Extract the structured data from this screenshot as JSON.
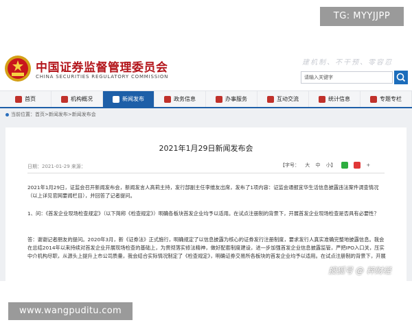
{
  "overlay": {
    "tg_badge": "TG: MYYJJPP",
    "bottom_badge": "www.wangpuditu.com",
    "watermark": "搜狐号 @ 粹财经"
  },
  "header": {
    "org_name_cn": "中国证券监督管理委员会",
    "org_name_en": "CHINA SECURITIES REGULATORY COMMISSION",
    "slogan": "建机制、不干预、零容忍",
    "search_placeholder": "请输入关键字"
  },
  "nav": {
    "items": [
      {
        "label": "首页",
        "active": false
      },
      {
        "label": "机构概况",
        "active": false
      },
      {
        "label": "新闻发布",
        "active": true
      },
      {
        "label": "政务信息",
        "active": false
      },
      {
        "label": "办事服务",
        "active": false
      },
      {
        "label": "互动交流",
        "active": false
      },
      {
        "label": "统计信息",
        "active": false
      },
      {
        "label": "专题专栏",
        "active": false
      }
    ]
  },
  "breadcrumb": "当前位置：首页>新闻发布>新闻发布会",
  "article": {
    "title": "2021年1月29日新闻发布会",
    "meta": "日期：2021-01-29  来源：",
    "font_label": "【字号：",
    "font_big": "大",
    "font_mid": "中",
    "font_small": "小】",
    "para1": "2021年1月29日，证监会召开新闻发布会，新闻发言人高莉主持，发行部副主任李维友出席，发布了1项内容：证监会通报宜华生活信息披露违法案件调查情况（以上详见官网要闻栏目），并回答了记者提问。",
    "para2": "1、问：《首发企业现场检查规定》（以下简称《检查规定》）明确各板块首发企业均予以适用。在试点注册制的背景下，开展首发企业现场检查是否具有必要性？",
    "para3": "答：谢谢记者朋友的提问。2020年3月，新《证券法》正式施行，明确规定了以信息披露为核心的证券发行注册制度，要求发行人真实准确完整地披露信息。我会在总结2014年以来持续对首发企业开展现场检查的基础上，为贯彻落实修法精神，做好配套制度建设，进一步加强首发企业信息披露监管，严把IPO入口关，压实中介机构尽职，从源头上提升上市公司质量，我会结合实际情况制定了《检查规定》，明确证券交易所各板块的首发企业均予以适用。在试点注册制的背景下，开展首发企业现场检查仍然有必要性："
  },
  "colors": {
    "brand_red": "#b3151b",
    "nav_blue": "#1d5fa8"
  }
}
